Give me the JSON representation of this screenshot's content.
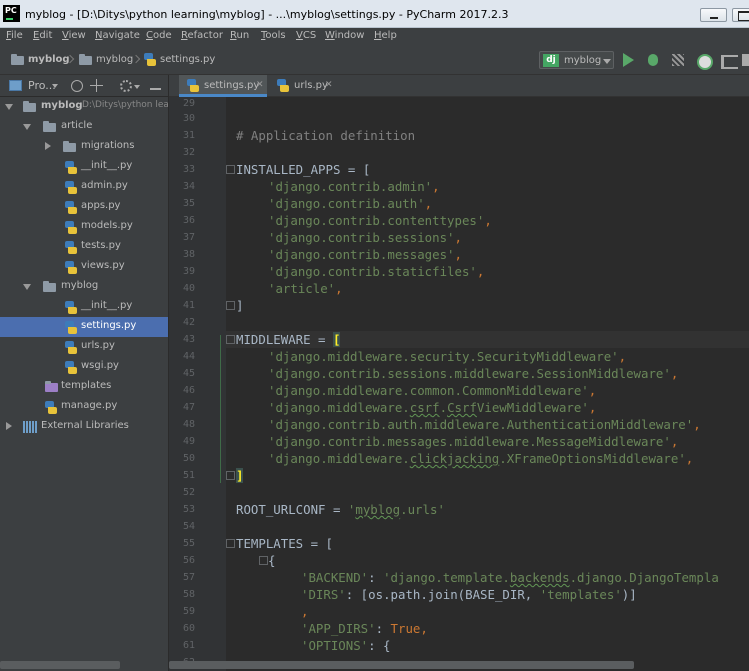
{
  "window": {
    "title": "myblog - [D:\\Ditys\\python learning\\myblog] - ...\\myblog\\settings.py - PyCharm 2017.2.3",
    "app_icon": "PC"
  },
  "menu": [
    "File",
    "Edit",
    "View",
    "Navigate",
    "Code",
    "Refactor",
    "Run",
    "Tools",
    "VCS",
    "Window",
    "Help"
  ],
  "breadcrumb": [
    "myblog",
    "myblog",
    "settings.py"
  ],
  "run_config": {
    "badge": "dj",
    "label": "myblog"
  },
  "project_panel": {
    "view_label": "Pro..."
  },
  "tree": [
    {
      "label": "myblog",
      "hint": "D:\\Ditys\\python lea",
      "bold": true
    },
    {
      "label": "article"
    },
    {
      "label": "migrations"
    },
    {
      "label": "__init__.py"
    },
    {
      "label": "admin.py"
    },
    {
      "label": "apps.py"
    },
    {
      "label": "models.py"
    },
    {
      "label": "tests.py"
    },
    {
      "label": "views.py"
    },
    {
      "label": "myblog"
    },
    {
      "label": "__init__.py"
    },
    {
      "label": "settings.py",
      "selected": true
    },
    {
      "label": "urls.py"
    },
    {
      "label": "wsgi.py"
    },
    {
      "label": "templates"
    },
    {
      "label": "manage.py"
    },
    {
      "label": "External Libraries"
    }
  ],
  "tabs": [
    {
      "label": "settings.py",
      "active": true
    },
    {
      "label": "urls.py",
      "active": false
    }
  ],
  "editor": {
    "line_numbers": [
      "29",
      "30",
      "31",
      "32",
      "33",
      "34",
      "35",
      "36",
      "37",
      "38",
      "39",
      "40",
      "41",
      "42",
      "43",
      "44",
      "45",
      "46",
      "47",
      "48",
      "49",
      "50",
      "51",
      "52",
      "53",
      "54",
      "55",
      "56",
      "57",
      "58",
      "59",
      "60",
      "61",
      "62"
    ],
    "code": {
      "l31": "# Application definition",
      "l33_a": "INSTALLED_APPS = [",
      "l34": "'django.contrib.admin'",
      "l35": "'django.contrib.auth'",
      "l36": "'django.contrib.contenttypes'",
      "l37": "'django.contrib.sessions'",
      "l38": "'django.contrib.messages'",
      "l39": "'django.contrib.staticfiles'",
      "l40": "'article'",
      "l41": "]",
      "l43_a": "MIDDLEWARE = ",
      "l43_b": "[",
      "l44": "'django.middleware.security.SecurityMiddleware'",
      "l45": "'django.contrib.sessions.middleware.SessionMiddleware'",
      "l46": "'django.middleware.common.CommonMiddleware'",
      "l47_a": "'django.middleware.",
      "l47_b": "csrf",
      "l47_c": ".",
      "l47_d": "Csrf",
      "l47_e": "ViewMiddleware'",
      "l48": "'django.contrib.auth.middleware.AuthenticationMiddleware'",
      "l49": "'django.contrib.messages.middleware.MessageMiddleware'",
      "l50_a": "'django.middleware.",
      "l50_b": "clickjacking",
      "l50_c": ".XFrameOptionsMiddleware'",
      "l51": "]",
      "l53_a": "ROOT_URLCONF = ",
      "l53_b": "'",
      "l53_c": "myblog",
      "l53_d": ".urls'",
      "l55": "TEMPLATES = [",
      "l56": "{",
      "l57_a": "'BACKEND'",
      "l57_b": ": ",
      "l57_c": "'django.template.",
      "l57_d": "backends",
      "l57_e": ".django.DjangoTempla",
      "l58_a": "'DIRS'",
      "l58_b": ": [os.path.join(BASE_DIR, ",
      "l58_c": "'templates'",
      "l58_d": ")]",
      "l59": ",",
      "l60_a": "'APP_DIRS'",
      "l60_b": ": ",
      "l60_c": "True",
      "l60_d": ",",
      "l61_a": "'OPTIONS'",
      "l61_b": ": {",
      "comma": ","
    }
  },
  "colors": {
    "keyword": "#cc7832",
    "string": "#6a8759",
    "comment": "#808080",
    "default": "#a9b7c6",
    "selection": "#4b6eaf",
    "tab_underline": "#4a88c7"
  }
}
